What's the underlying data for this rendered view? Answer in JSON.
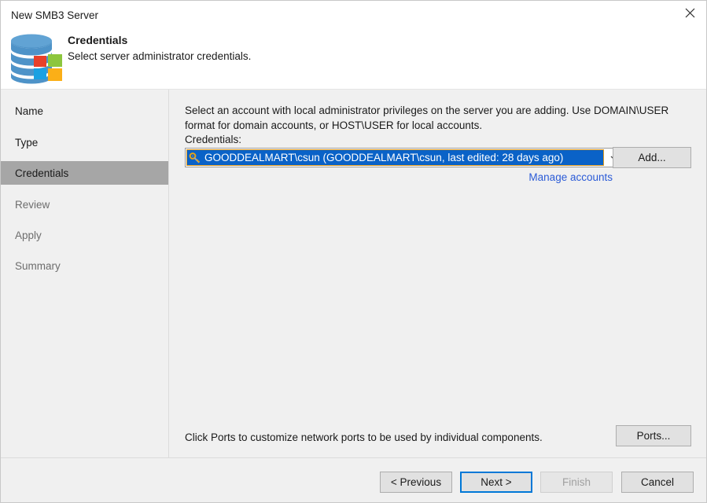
{
  "window": {
    "title": "New SMB3 Server",
    "close_icon": "close-icon"
  },
  "header": {
    "icon": "database-windows-icon",
    "heading": "Credentials",
    "subheading": "Select server administrator credentials."
  },
  "sidebar": {
    "items": [
      {
        "label": "Name",
        "selected": false,
        "enabled": true
      },
      {
        "label": "Type",
        "selected": false,
        "enabled": true
      },
      {
        "label": "Credentials",
        "selected": true,
        "enabled": true
      },
      {
        "label": "Review",
        "selected": false,
        "enabled": false
      },
      {
        "label": "Apply",
        "selected": false,
        "enabled": false
      },
      {
        "label": "Summary",
        "selected": false,
        "enabled": false
      }
    ]
  },
  "main": {
    "intro_text": "Select an account with local administrator privileges on the server you are adding. Use DOMAIN\\USER format for domain accounts, or HOST\\USER for local accounts.",
    "credentials_label": "Credentials:",
    "credentials_combo": {
      "icon": "key-icon",
      "value": "GOODDEALMART\\csun (GOODDEALMART\\csun, last edited: 28 days ago)",
      "dropdown_icon": "chevron-down-icon"
    },
    "add_button_label": "Add...",
    "manage_accounts_link": "Manage accounts",
    "ports_note": "Click Ports to customize network ports to be used by individual components.",
    "ports_button_label": "Ports..."
  },
  "footer": {
    "previous_label": "< Previous",
    "next_label": "Next >",
    "finish_label": "Finish",
    "cancel_label": "Cancel"
  },
  "colors": {
    "selection_blue": "#0a62c7",
    "focus_blue": "#0078d7",
    "link_blue": "#2b5bd7",
    "sidebar_selected_gray": "#a6a6a6",
    "panel_gray": "#f0f0f0"
  }
}
